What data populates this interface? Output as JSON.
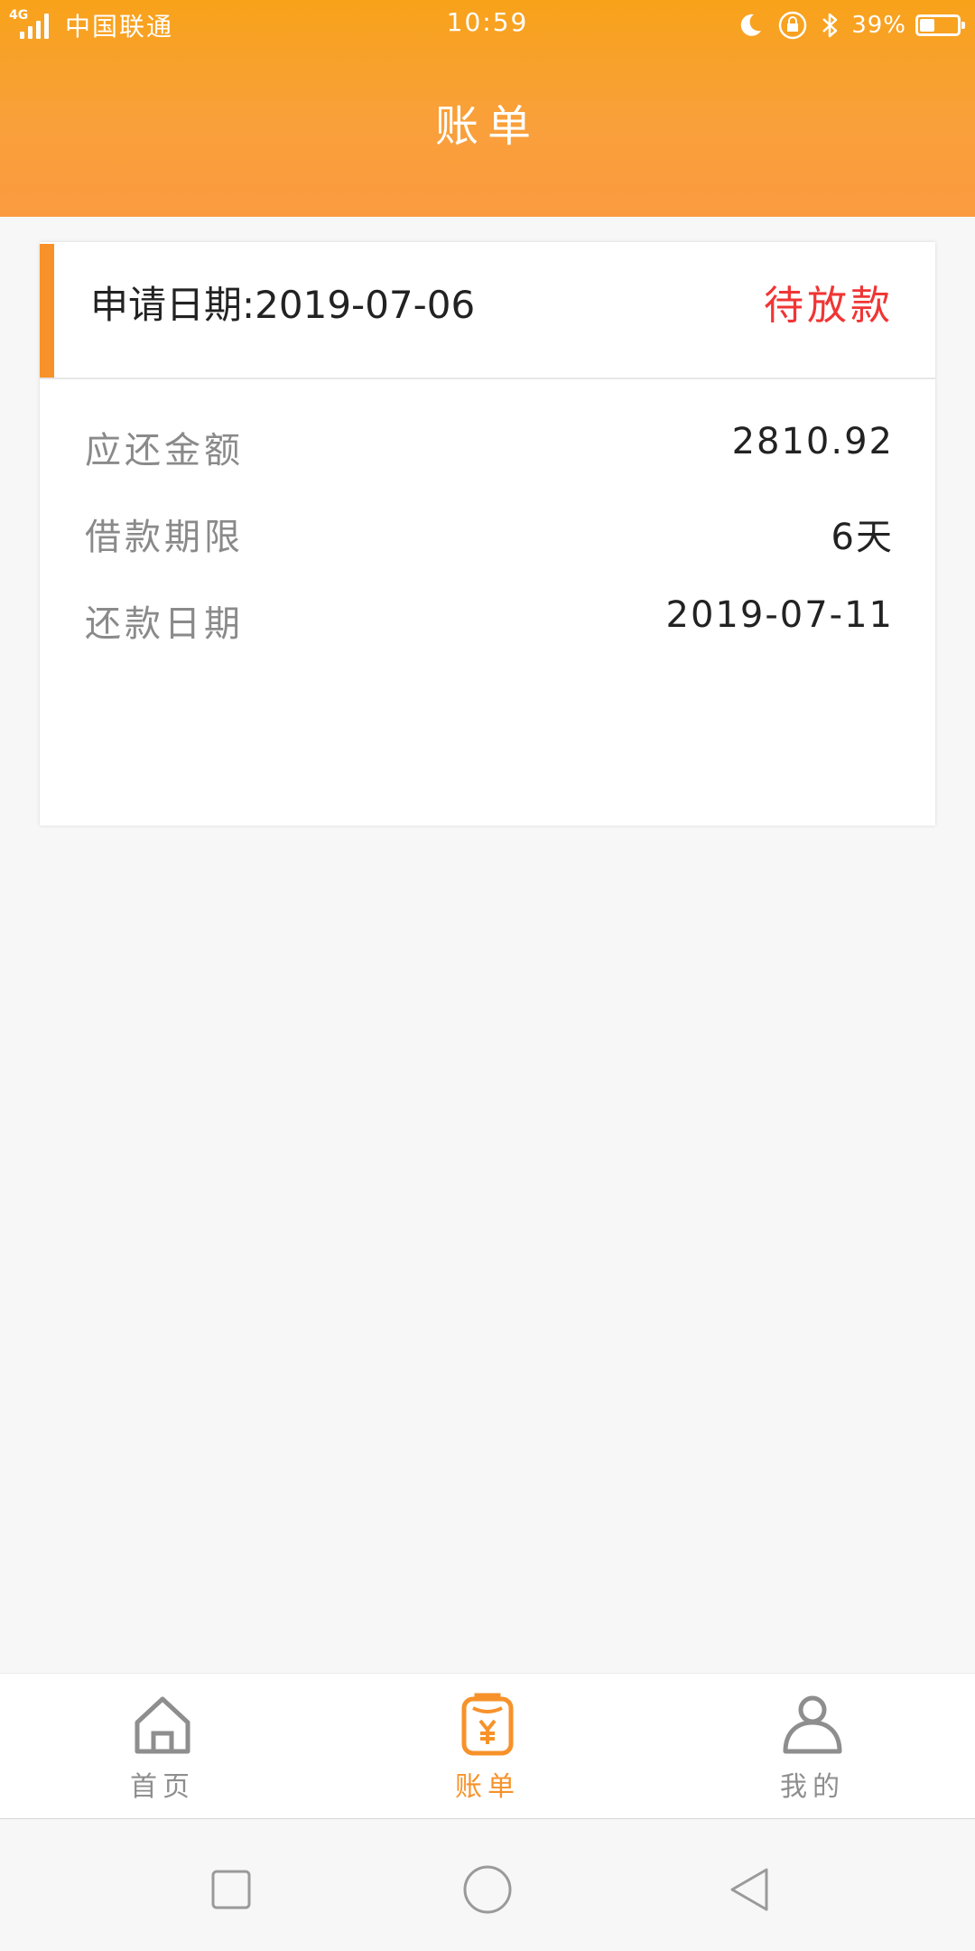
{
  "status_bar": {
    "network": "4G",
    "carrier": "中国联通",
    "time": "10:59",
    "battery_percent": "39%",
    "battery_level": 0.39
  },
  "header": {
    "title": "账单"
  },
  "bill_card": {
    "apply_date": "申请日期:2019-07-06",
    "status": "待放款",
    "status_color": "#f03535",
    "accent_color": "#f7922a",
    "rows": [
      {
        "label": "应还金额",
        "value": "2810.92"
      },
      {
        "label": "借款期限",
        "value": "6天"
      },
      {
        "label": "还款日期",
        "value": "2019-07-11"
      }
    ]
  },
  "tab_bar": {
    "tabs": [
      {
        "label": "首页",
        "icon": "home-icon",
        "active": false
      },
      {
        "label": "账单",
        "icon": "bill-icon",
        "active": true
      },
      {
        "label": "我的",
        "icon": "profile-icon",
        "active": false
      }
    ],
    "active_color": "#f7922a",
    "inactive_color": "#8e8e8e"
  },
  "nav_bar": {
    "buttons": [
      "recent-apps-icon",
      "home-circle-icon",
      "back-icon"
    ]
  }
}
